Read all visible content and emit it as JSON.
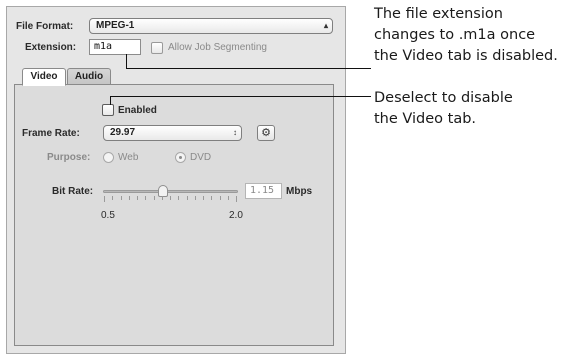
{
  "file_format": {
    "label": "File Format:",
    "value": "MPEG-1"
  },
  "extension": {
    "label": "Extension:",
    "value": "m1a"
  },
  "allow_job_segmenting": {
    "label": "Allow Job Segmenting",
    "checked": false
  },
  "tabs": [
    {
      "label": "Video",
      "selected": true
    },
    {
      "label": "Audio",
      "selected": false
    }
  ],
  "enabled": {
    "label": "Enabled",
    "checked": false
  },
  "frame_rate": {
    "label": "Frame Rate:",
    "value": "29.97"
  },
  "purpose": {
    "label": "Purpose:",
    "options": [
      {
        "label": "Web",
        "selected": false
      },
      {
        "label": "DVD",
        "selected": true
      }
    ]
  },
  "bit_rate": {
    "label": "Bit Rate:",
    "value": "1.15",
    "unit": "Mbps",
    "min_label": "0.5",
    "max_label": "2.0"
  },
  "annotations": {
    "top": [
      "The file extension",
      "changes to .m1a once",
      "the Video tab is disabled."
    ],
    "bottom": [
      "Deselect to disable",
      "the Video tab."
    ]
  }
}
